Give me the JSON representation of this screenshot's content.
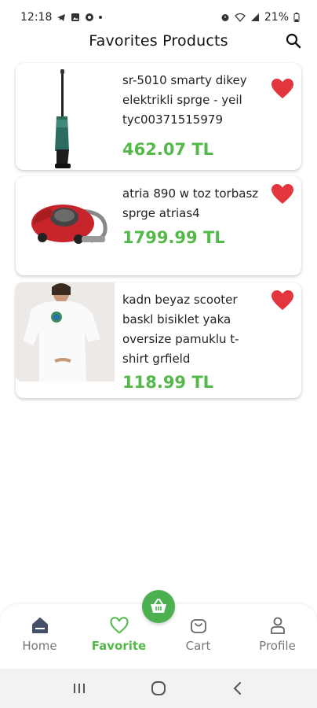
{
  "status_bar": {
    "time": "12:18",
    "battery": "21%"
  },
  "header": {
    "title": "Favorites Products"
  },
  "products": [
    {
      "name": "sr-5010 smarty dikey elektrikli sprge - yeil tyc00371515979",
      "price": "462.07 TL",
      "image": "stick-vacuum-image",
      "favorited": true
    },
    {
      "name": "atria 890 w toz torbasz sprge atrias4",
      "price": "1799.99 TL",
      "image": "canister-vacuum-image",
      "favorited": true
    },
    {
      "name": "kadn beyaz scooter baskl bisiklet yaka oversize pamuklu t-shirt grfield",
      "price": "118.99 TL",
      "image": "white-tshirt-image",
      "favorited": true
    }
  ],
  "bottom_nav": {
    "items": [
      {
        "label": "Home",
        "icon": "home-icon",
        "active": false
      },
      {
        "label": "Favorite",
        "icon": "heart-outline-icon",
        "active": true
      },
      {
        "label": "Cart",
        "icon": "cart-icon",
        "active": false
      },
      {
        "label": "Profile",
        "icon": "person-icon",
        "active": false
      }
    ],
    "fab_icon": "basket-icon"
  },
  "colors": {
    "accent_green": "#55b84a",
    "heart_red": "#e3353d"
  }
}
